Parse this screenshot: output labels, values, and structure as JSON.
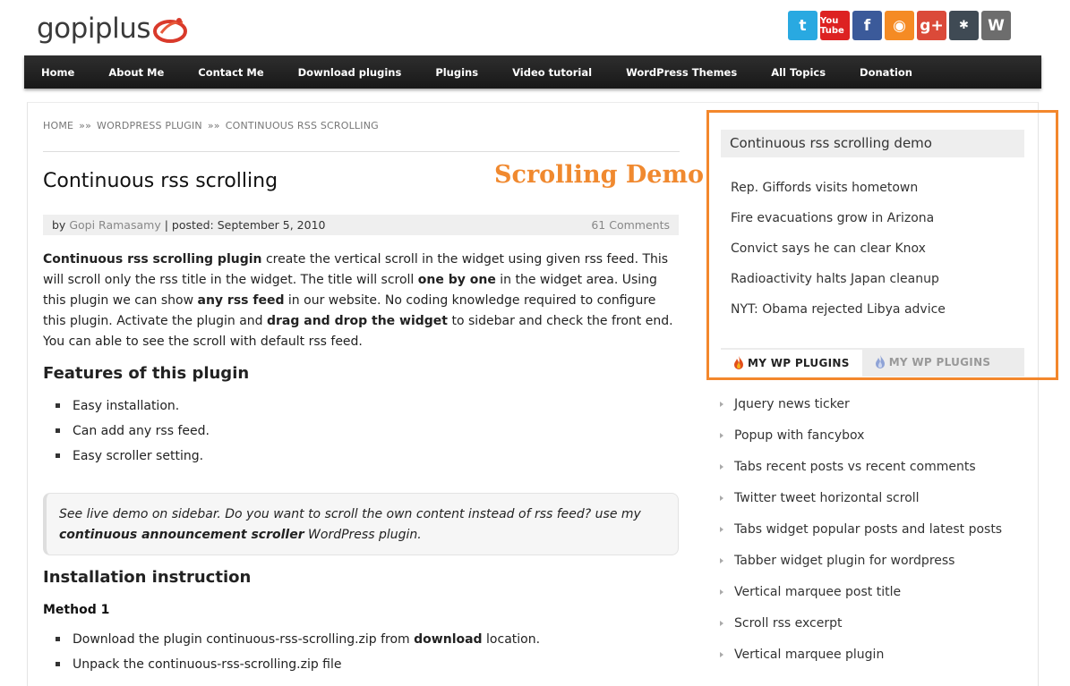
{
  "header": {
    "logo_text": "gopiplus",
    "social_icons": [
      {
        "name": "twitter-icon",
        "glyph": "t"
      },
      {
        "name": "youtube-icon",
        "glyph": "You Tube"
      },
      {
        "name": "facebook-icon",
        "glyph": "f"
      },
      {
        "name": "rss-icon",
        "glyph": "◉"
      },
      {
        "name": "google-plus-icon",
        "glyph": "g+"
      },
      {
        "name": "joomla-icon",
        "glyph": "✱"
      },
      {
        "name": "wordpress-icon",
        "glyph": "W"
      }
    ]
  },
  "nav": {
    "items": [
      "Home",
      "About Me",
      "Contact Me",
      "Download plugins",
      "Plugins",
      "Video tutorial",
      "WordPress Themes",
      "All Topics",
      "Donation"
    ]
  },
  "breadcrumb": {
    "home": "HOME",
    "section": "WORDPRESS PLUGIN",
    "current": "CONTINUOUS RSS SCROLLING",
    "separator": "»»"
  },
  "post": {
    "title": "Continuous rss scrolling",
    "demo_label": "Scrolling Demo",
    "meta_by": "by",
    "author": "Gopi Ramasamy",
    "meta_posted": "| posted: September 5, 2010",
    "comments": "61 Comments",
    "intro": {
      "b1": "Continuous rss scrolling plugin",
      "t1": " create the vertical scroll in the widget using given rss feed. This will scroll only the rss title in the widget. The title will scroll ",
      "b2": "one by one",
      "t2": " in the widget area. Using this plugin we can show ",
      "b3": "any rss feed",
      "t3": " in our website. No coding knowledge required to configure this plugin. Activate the plugin and ",
      "b4": "drag and drop the widget",
      "t4": " to sidebar and check the front end. You can able to see the scroll with default rss feed."
    },
    "features_heading": "Features of this plugin",
    "features": [
      "Easy installation.",
      "Can add any rss feed.",
      "Easy scroller setting."
    ],
    "quote": {
      "t1": "See live demo on sidebar. Do you want to scroll the own content instead of rss feed? use my ",
      "b1": "continuous announcement scroller",
      "t2": " WordPress plugin."
    },
    "install_heading": "Installation instruction",
    "method_heading": "Method 1",
    "method_steps": [
      {
        "t1": "Download the plugin continuous-rss-scrolling.zip from ",
        "b1": "download",
        "t2": " location."
      },
      {
        "t1": "Unpack the continuous-rss-scrolling.zip file",
        "b1": "",
        "t2": ""
      }
    ]
  },
  "sidebar": {
    "widget_title": "Continuous rss scrolling demo",
    "rss_items": [
      "Rep. Giffords visits hometown",
      "Fire evacuations grow in Arizona",
      "Convict says he can clear Knox",
      "Radioactivity halts Japan cleanup",
      "NYT: Obama rejected Libya advice"
    ],
    "tabs": [
      "MY WP PLUGINS",
      "MY WP PLUGINS"
    ],
    "plugin_links": [
      "Jquery news ticker",
      "Popup with fancybox",
      "Tabs recent posts vs recent comments",
      "Twitter tweet horizontal scroll",
      "Tabs widget popular posts and latest posts",
      "Tabber widget plugin for wordpress",
      "Vertical marquee post title",
      "Scroll rss excerpt",
      "Vertical marquee plugin"
    ]
  },
  "colors": {
    "accent_orange": "#f3872c",
    "nav_bg": "#222222"
  }
}
